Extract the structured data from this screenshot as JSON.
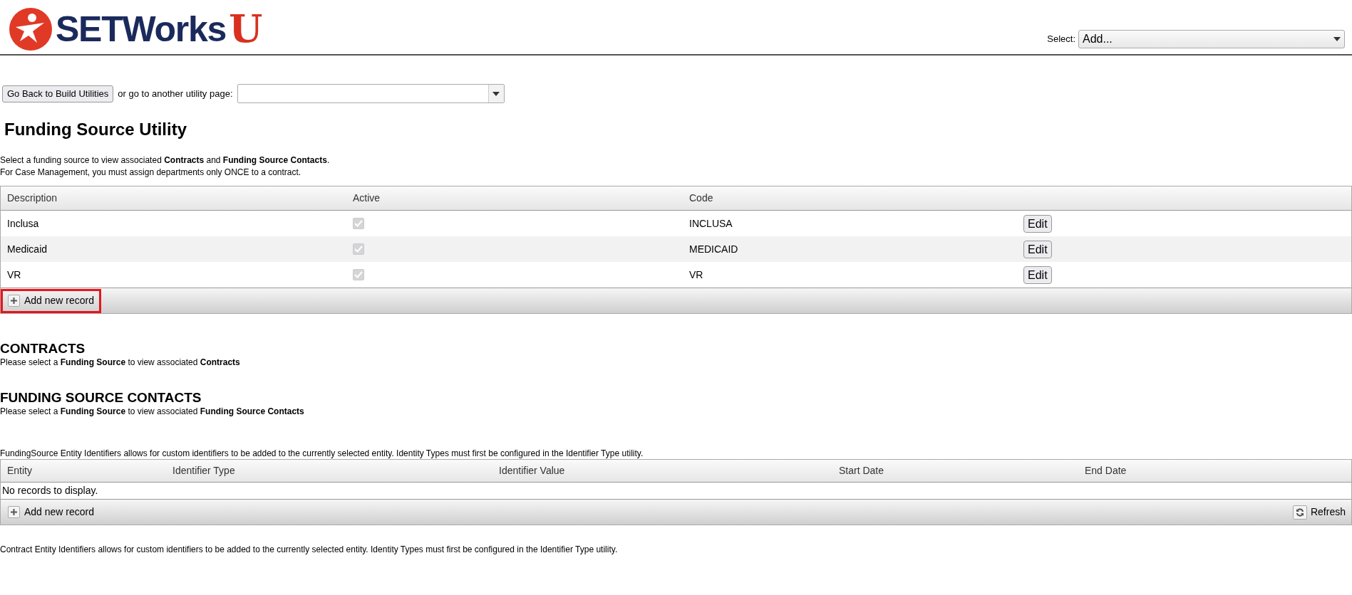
{
  "header": {
    "logo_text": "SETWorks",
    "logo_mark": "U",
    "select_label": "Select:",
    "select_value": "Add..."
  },
  "nav": {
    "back_button": "Go Back to Build Utilities",
    "or_text": "or go to another utility page:"
  },
  "title": "Funding Source Utility",
  "intro": [
    "Select a funding source to view associated **Contracts** and **Funding Source Contacts**.",
    "For Case Management, you must assign departments only ONCE to a contract."
  ],
  "funding_table": {
    "columns": [
      "Description",
      "Active",
      "Code"
    ],
    "rows": [
      {
        "description": "Inclusa",
        "active": true,
        "code": "INCLUSA",
        "action": "Edit"
      },
      {
        "description": "Medicaid",
        "active": true,
        "code": "MEDICAID",
        "action": "Edit"
      },
      {
        "description": "VR",
        "active": true,
        "code": "VR",
        "action": "Edit"
      }
    ],
    "add_button": {
      "label": "Add new record",
      "highlighted": true
    }
  },
  "sections": [
    {
      "heading": "CONTRACTS",
      "text": "Please select a **Funding Source** to view associated **Contracts**"
    },
    {
      "heading": "FUNDING SOURCE CONTACTS",
      "text": "Please select a **Funding Source** to view associated **Funding Source Contacts**"
    }
  ],
  "identifiers_intro": "FundingSource Entity Identifiers allows for custom identifiers to be added to the currently selected entity. Identity Types must first be configured in the Identifier Type utility.",
  "identifiers_table": {
    "columns": [
      "Entity",
      "Identifier Type",
      "Identifier Value",
      "Start Date",
      "End Date"
    ],
    "empty_text": "No records to display.",
    "add_button": {
      "label": "Add new record",
      "highlighted": false
    },
    "refresh_button": "Refresh"
  },
  "contract_identifiers_intro": "Contract Entity Identifiers allows for custom identifiers to be added to the currently selected entity. Identity Types must first be configured in the Identifier Type utility."
}
